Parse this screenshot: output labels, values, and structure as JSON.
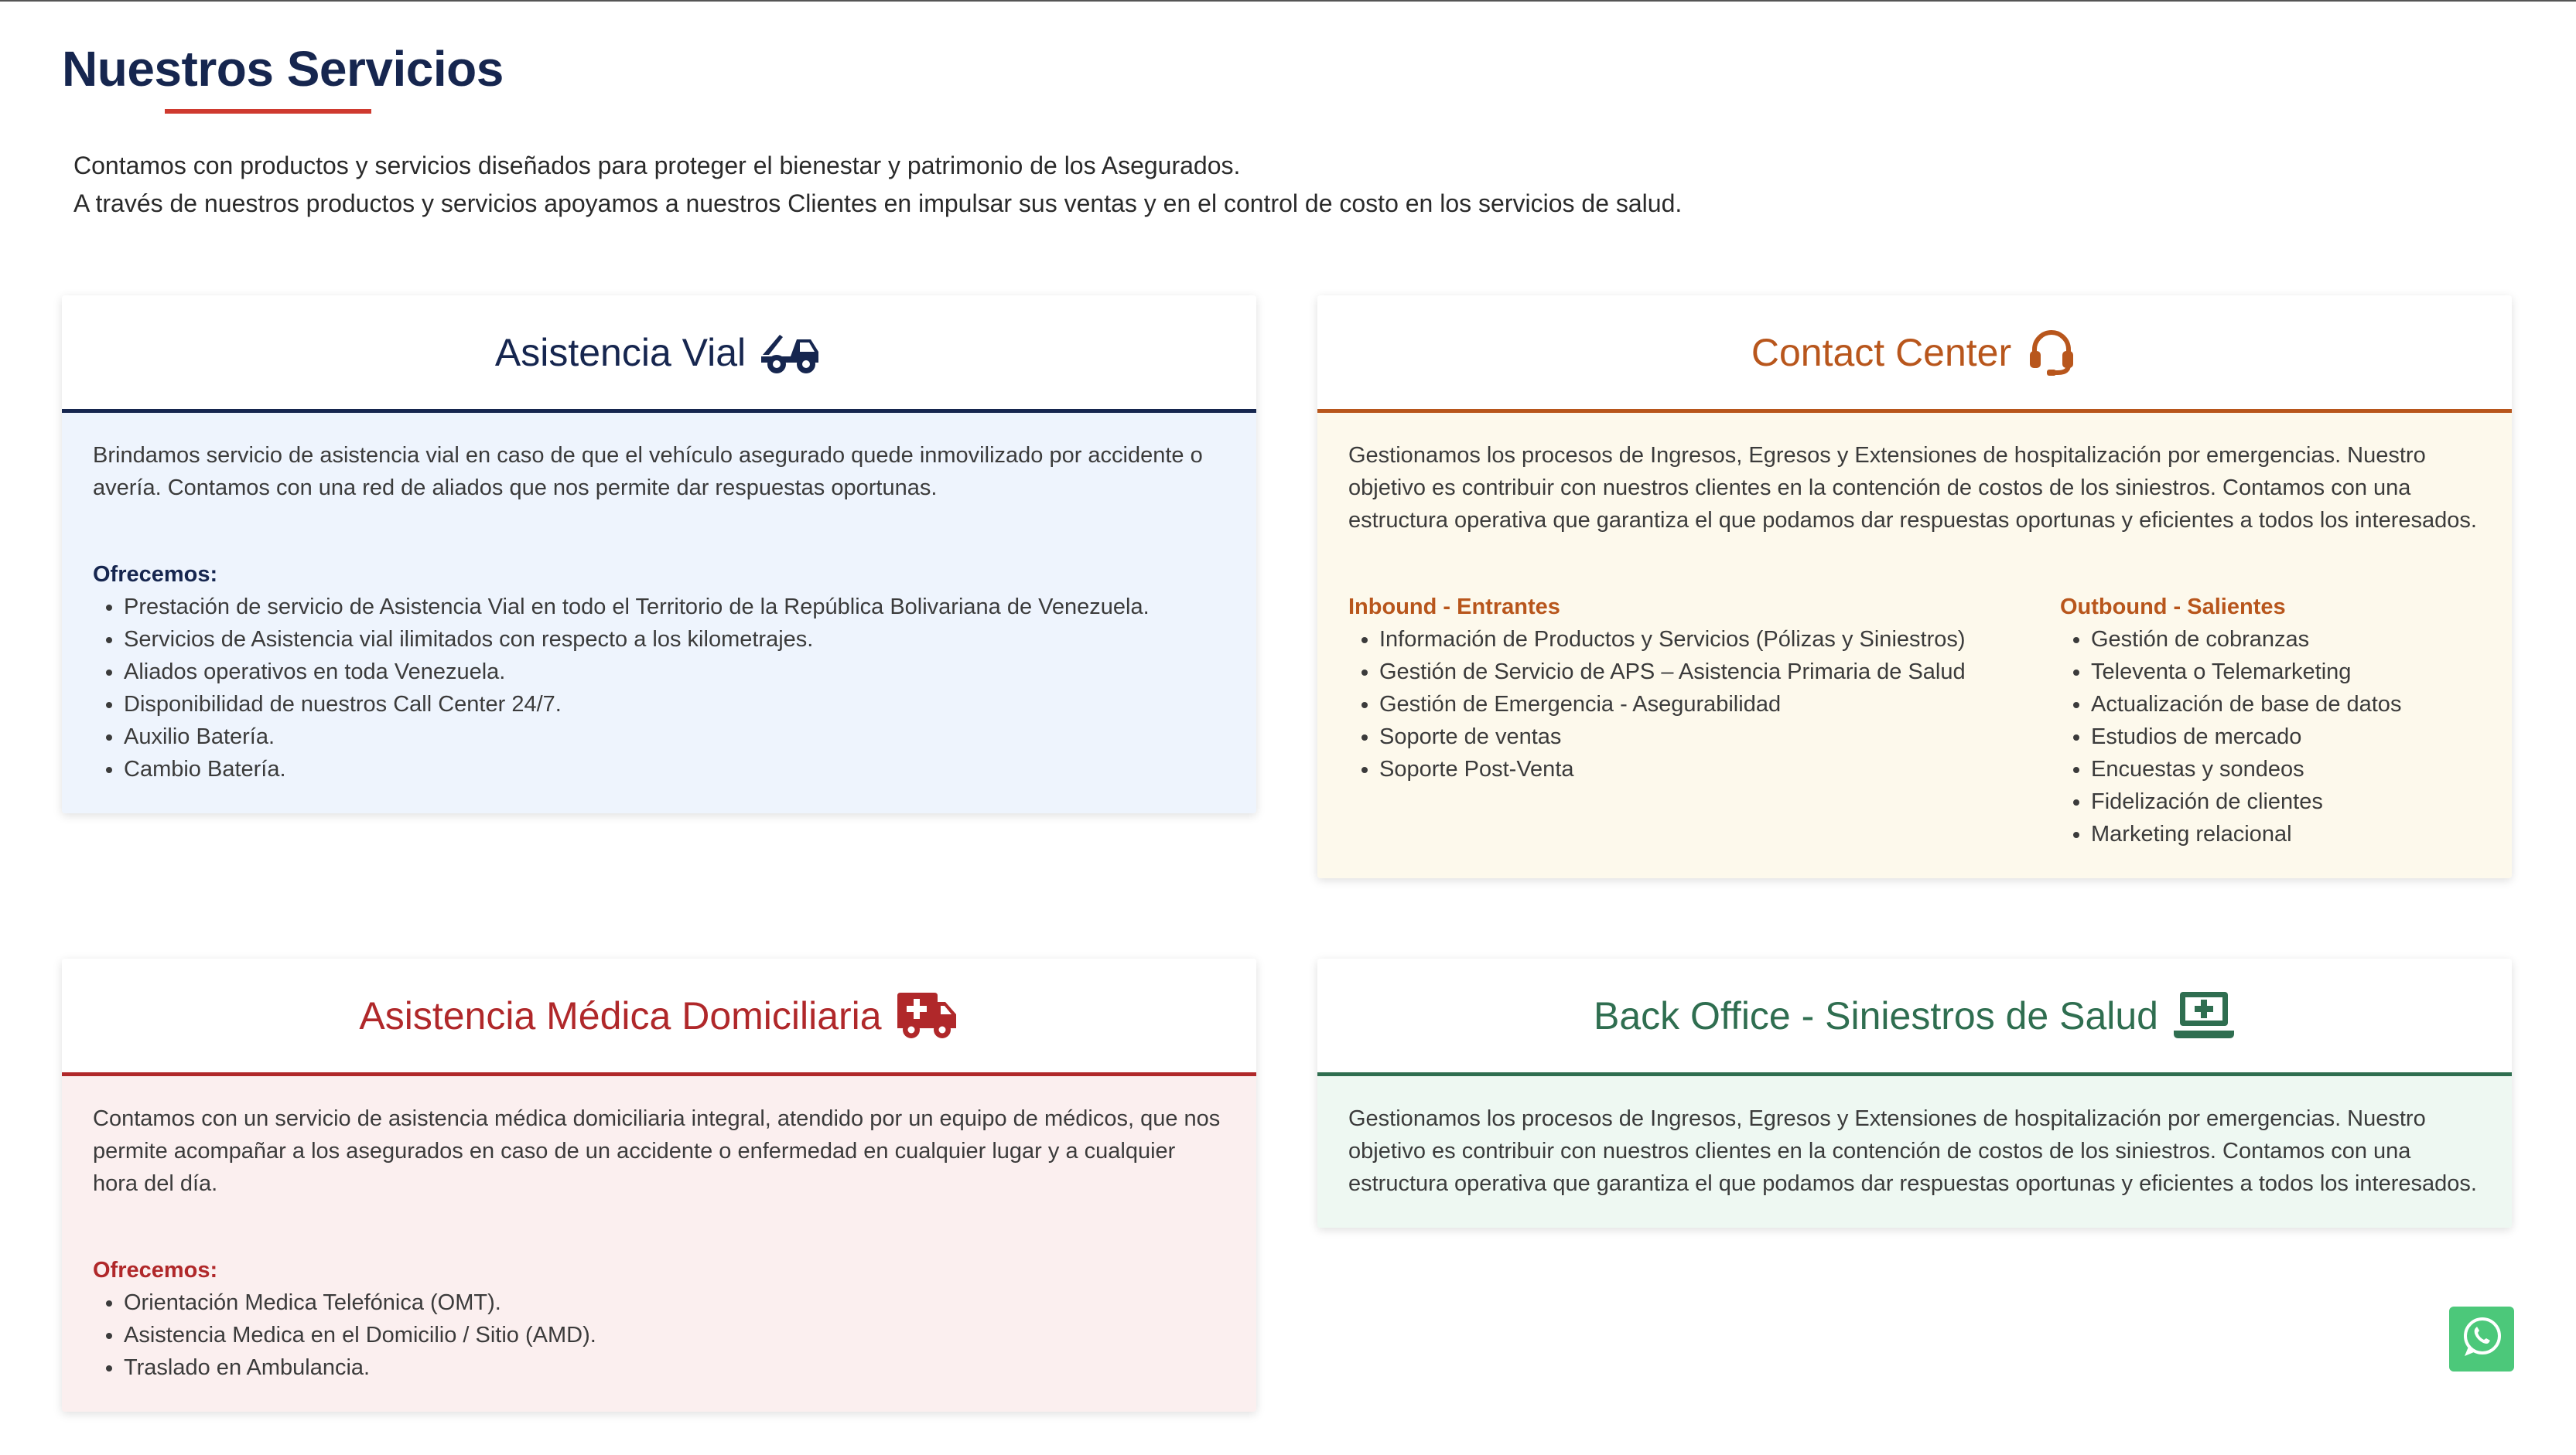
{
  "header": {
    "title": "Nuestros Servicios",
    "intro": [
      "Contamos con productos y servicios diseñados para proteger el bienestar y patrimonio de los Asegurados.",
      "A través de nuestros productos y servicios apoyamos a nuestros Clientes en impulsar sus ventas y en el control de costo en los servicios de salud."
    ]
  },
  "cards": {
    "vial": {
      "title": "Asistencia Vial",
      "icon": "tow-truck-icon",
      "color": "#16264f",
      "body": "Brindamos servicio de asistencia vial en caso de que el vehículo asegurado quede inmovilizado por accidente o avería. Contamos con una red de aliados que nos permite dar respuestas oportunas.",
      "offer_title": "Ofrecemos:",
      "items": [
        "Prestación de servicio de Asistencia Vial en todo el Territorio de la República Bolivariana de Venezuela.",
        "Servicios de Asistencia vial ilimitados con respecto a los kilometrajes.",
        "Aliados operativos en toda Venezuela.",
        "Disponibilidad de nuestros Call Center 24/7.",
        "Auxilio Batería.",
        "Cambio Batería."
      ]
    },
    "contact": {
      "title": "Contact Center",
      "icon": "headset-icon",
      "color": "#b8561c",
      "body": "Gestionamos los procesos de Ingresos, Egresos y Extensiones de hospitalización por emergencias. Nuestro objetivo es contribuir con nuestros clientes en la contención de costos de los siniestros. Contamos con una estructura operativa que garantiza el que podamos dar respuestas oportunas y eficientes a todos los interesados.",
      "inbound_title": "Inbound - Entrantes",
      "inbound": [
        "Información de Productos y Servicios (Pólizas y Siniestros)",
        "Gestión de Servicio de APS – Asistencia Primaria de Salud",
        "Gestión de Emergencia - Asegurabilidad",
        "Soporte de ventas",
        "Soporte Post-Venta"
      ],
      "outbound_title": "Outbound - Salientes",
      "outbound": [
        "Gestión de cobranzas",
        "Televenta o Telemarketing",
        "Actualización de base de datos",
        "Estudios de mercado",
        "Encuestas y sondeos",
        "Fidelización de clientes",
        "Marketing relacional"
      ]
    },
    "medica": {
      "title": "Asistencia Médica Domiciliaria",
      "icon": "ambulance-icon",
      "color": "#b0282a",
      "body": "Contamos con un servicio de asistencia médica domiciliaria integral, atendido por un equipo de médicos, que nos permite acompañar a los asegurados en caso de un accidente o enfermedad en cualquier lugar y a cualquier hora del día.",
      "offer_title": "Ofrecemos:",
      "items": [
        "Orientación Medica Telefónica (OMT).",
        "Asistencia Medica en el Domicilio / Sitio (AMD).",
        "Traslado en Ambulancia."
      ]
    },
    "backoffice": {
      "title": "Back Office - Siniestros de Salud",
      "icon": "laptop-medical-icon",
      "color": "#2f6e50",
      "body": "Gestionamos los procesos de Ingresos, Egresos y Extensiones de hospitalización por emergencias. Nuestro objetivo es contribuir con nuestros clientes en la contención de costos de los siniestros. Contamos con una estructura operativa que garantiza el que podamos dar respuestas oportunas y eficientes a todos los interesados."
    }
  },
  "whatsapp": {
    "icon": "whatsapp-icon",
    "color": "#4cc87a"
  }
}
